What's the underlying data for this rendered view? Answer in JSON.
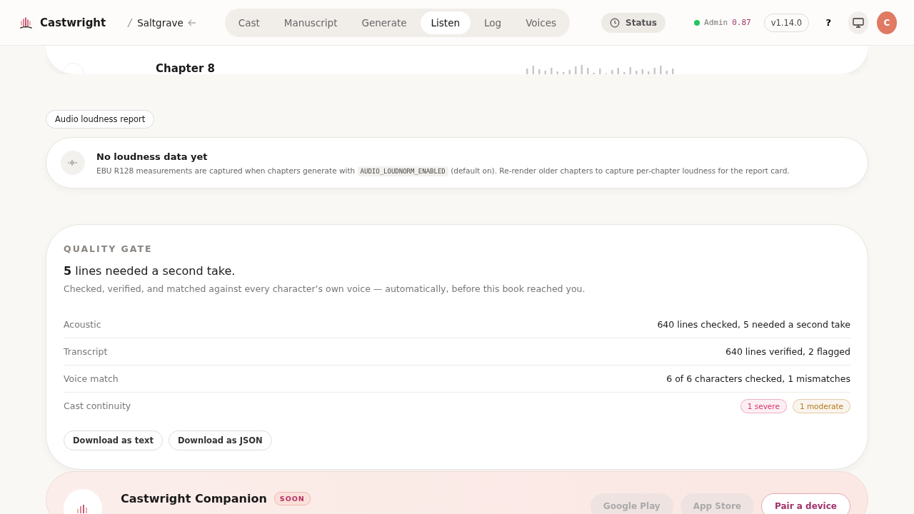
{
  "header": {
    "brand": "Castwright",
    "project": "Saltgrave",
    "tabs": [
      {
        "label": "Cast",
        "selected": false
      },
      {
        "label": "Manuscript",
        "selected": false
      },
      {
        "label": "Generate",
        "selected": false
      },
      {
        "label": "Listen",
        "selected": true
      },
      {
        "label": "Log",
        "selected": false
      },
      {
        "label": "Voices",
        "selected": false
      }
    ],
    "status": "Status",
    "role": "Admin",
    "score": "0.87",
    "version": "v1.14.0",
    "help": "?",
    "avatar": "C"
  },
  "chapter": {
    "title": "Chapter 8"
  },
  "loudness": {
    "chip": "Audio loudness report",
    "title": "No loudness data yet",
    "body_before": "EBU R128 measurements are captured when chapters generate with",
    "code": "AUDIO_LOUDNORM_ENABLED",
    "body_after": "(default on). Re-render older chapters to capture per-chapter loudness for the report card."
  },
  "quality": {
    "eyebrow": "QUALITY GATE",
    "headline": "**5** lines needed a second take.",
    "subtitle": "Checked, verified, and matched against every character’s own voice — automatically, before this book reached you.",
    "rows": [
      {
        "label": "Acoustic",
        "kind": "text",
        "value": "640 lines checked, 5 needed a second take"
      },
      {
        "label": "Transcript",
        "kind": "text",
        "value": "640 lines verified, 2 flagged"
      },
      {
        "label": "Voice match",
        "kind": "text",
        "value": "6 of 6 characters checked, 1 mismatches"
      },
      {
        "label": "Cast continuity",
        "kind": "tags",
        "tags": [
          {
            "text": "1 severe",
            "color": "#d6336c"
          },
          {
            "text": "1 moderate",
            "color": "#b7791f"
          }
        ]
      }
    ],
    "buttons": [
      "Download as text",
      "Download as JSON"
    ]
  },
  "companion": {
    "title": "Castwright Companion",
    "badge": "SOON",
    "buttons": [
      {
        "label": "Google Play",
        "kind": "store"
      },
      {
        "label": "App Store",
        "kind": "store"
      },
      {
        "label": "Pair a device",
        "kind": "pair"
      }
    ]
  }
}
